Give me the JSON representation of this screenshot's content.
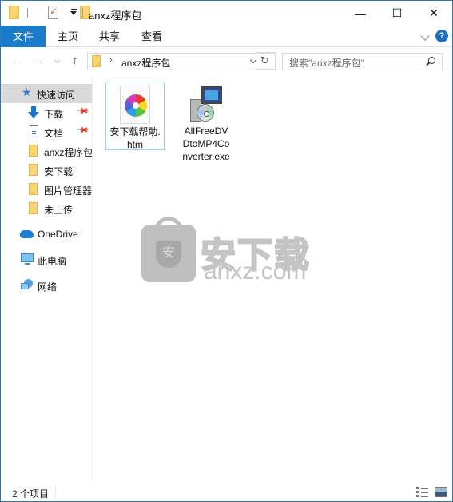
{
  "window": {
    "title": "anxz程序包",
    "controls": {
      "minimize": "—",
      "maximize": "☐",
      "close": "✕"
    }
  },
  "ribbon": {
    "tabs": [
      {
        "label": "文件",
        "active": true
      },
      {
        "label": "主页"
      },
      {
        "label": "共享"
      },
      {
        "label": "查看"
      }
    ],
    "help_icon": "?"
  },
  "navigation": {
    "back": "←",
    "forward": "→",
    "up": "↑",
    "address_segments": [
      "anxz程序包"
    ],
    "address_separator": "›",
    "refresh": "↻",
    "search_placeholder": "搜索\"anxz程序包\""
  },
  "sidebar": {
    "items": [
      {
        "label": "快速访问",
        "icon": "star-icon",
        "active": true
      },
      {
        "label": "下载",
        "icon": "download-icon",
        "pinned": true
      },
      {
        "label": "文档",
        "icon": "document-icon",
        "pinned": true
      },
      {
        "label": "anxz程序包",
        "icon": "folder-icon"
      },
      {
        "label": "安下载",
        "icon": "folder-icon"
      },
      {
        "label": "图片管理器",
        "icon": "folder-icon"
      },
      {
        "label": "未上传",
        "icon": "folder-icon"
      },
      {
        "label": "OneDrive",
        "icon": "onedrive-icon"
      },
      {
        "label": "此电脑",
        "icon": "computer-icon"
      },
      {
        "label": "网络",
        "icon": "network-icon"
      }
    ],
    "pin_glyph": "📌"
  },
  "files": [
    {
      "name": "安下载帮助.htm",
      "icon": "htm-file-icon",
      "selected": true
    },
    {
      "name": "AllFreeDVDtoMP4Converter.exe",
      "icon": "installer-exe-icon",
      "selected": false
    }
  ],
  "watermark": {
    "brand_cn": "安下载",
    "brand_en": "anxz.com",
    "shield_char": "安"
  },
  "status": {
    "item_count": "2 个项目"
  }
}
